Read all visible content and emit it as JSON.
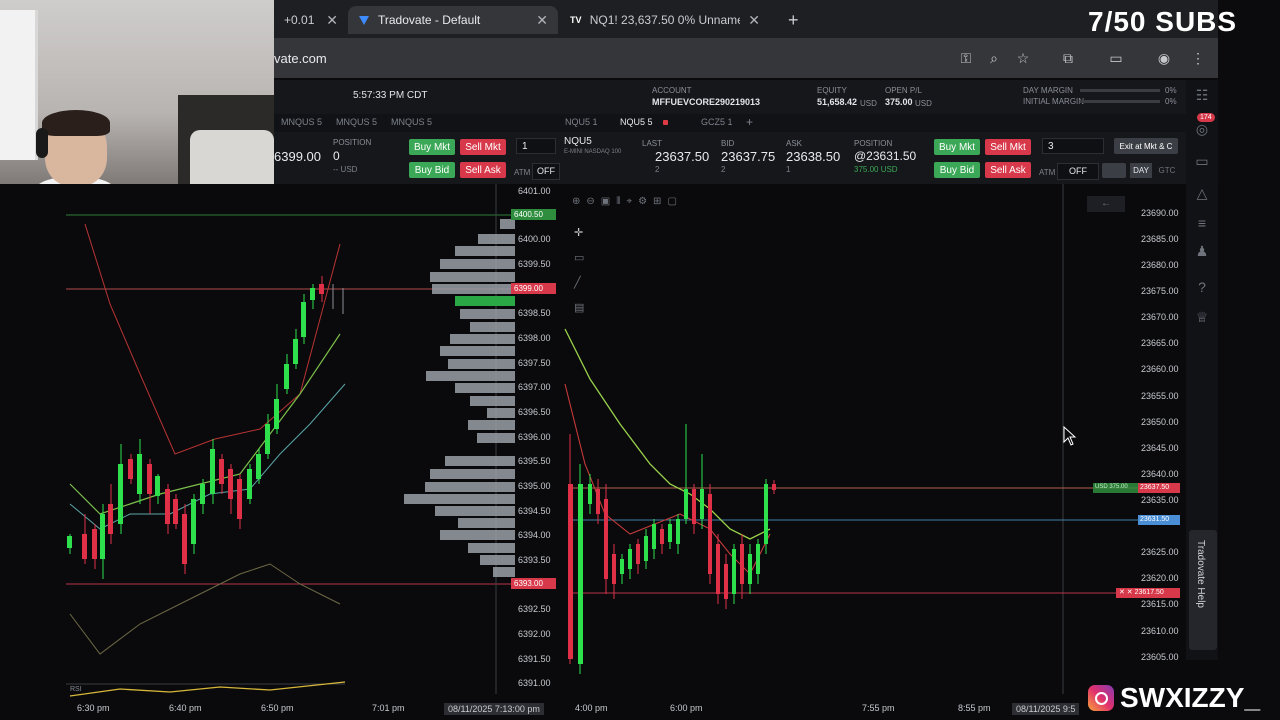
{
  "overlay": {
    "subs_counter": "7/50 SUBS",
    "social_handle": "SWXIZZY_"
  },
  "browser": {
    "tabs": [
      {
        "label": "+0.01",
        "icon": "partial-tab"
      },
      {
        "label": "Tradovate - Default",
        "icon": "tradovate-logo",
        "active": true
      },
      {
        "label": "NQ1! 23,637.50 0% Unname",
        "icon": "tradingview-logo"
      }
    ],
    "new_tab": "+",
    "url": "vate.com"
  },
  "app": {
    "time": "5:57:33 PM CDT",
    "account_label": "ACCOUNT",
    "account": "MFFUEVCORE290219013",
    "equity_label": "EQUITY",
    "equity": "51,658.42",
    "equity_unit": "USD",
    "open_pl_label": "OPEN P/L",
    "open_pl": "375.00",
    "open_pl_unit": "USD",
    "day_margin_label": "DAY MARGIN",
    "initial_margin_label": "INITIAL MARGIN",
    "day_margin_pct": "0%",
    "initial_margin_pct": "0%",
    "notif_badge": "174"
  },
  "left_panel": {
    "tabs": [
      "MNQUS 5",
      "MNQUS 5",
      "MNQUS 5"
    ],
    "last_price": "6399.00",
    "position_label": "POSITION",
    "position": "0",
    "pl_unit": "-- USD",
    "buy_mkt": "Buy Mkt",
    "sell_mkt": "Sell Mkt",
    "buy_bid": "Buy Bid",
    "sell_ask": "Sell Ask",
    "qty": "1",
    "atm": "ATM",
    "atm_state": "OFF"
  },
  "right_panel": {
    "tabs": [
      "NQU5 1",
      "NQU5 5",
      "GCZ5 1"
    ],
    "symbol": "NQU5",
    "symbol_sub": "E-MINI NASDAQ 100",
    "last_label": "LAST",
    "last": "23637.50",
    "last_sub": "2",
    "bid_label": "BID",
    "bid": "23637.75",
    "bid_sub": "2",
    "ask_label": "ASK",
    "ask": "23638.50",
    "ask_sub": "1",
    "position_label": "POSITION",
    "position": "@23631.50",
    "position_sub": "375.00 USD",
    "buy_mkt": "Buy Mkt",
    "sell_mkt": "Sell Mkt",
    "buy_bid": "Buy Bid",
    "sell_ask": "Sell Ask",
    "qty": "3",
    "exit_btn": "Exit at Mkt & C",
    "atm": "ATM",
    "atm_state": "OFF",
    "tif": "DAY",
    "tif2": "GTC"
  },
  "left_chart": {
    "y_labels": [
      "6401.00",
      "6400.00",
      "6399.50",
      "6399.00",
      "6398.50",
      "6398.00",
      "6397.50",
      "6397.00",
      "6396.50",
      "6396.00",
      "6395.50",
      "6395.00",
      "6394.50",
      "6394.00",
      "6393.50",
      "6393.00",
      "6392.50",
      "6392.00",
      "6391.50",
      "6391.00"
    ],
    "highlight_top": "6400.50",
    "highlight_red": "6399.00",
    "highlight_bottom": "6393.00",
    "x_labels": [
      "6:30 pm",
      "6:40 pm",
      "6:50 pm",
      "7:01 pm"
    ],
    "date_label": "08/11/2025 7:13:00 pm",
    "indicator_label": "RSI"
  },
  "right_chart": {
    "y_labels": [
      "23690.00",
      "23685.00",
      "23680.00",
      "23675.00",
      "23670.00",
      "23665.00",
      "23660.00",
      "23655.00",
      "23650.00",
      "23645.00",
      "23640.00",
      "23635.00",
      "23630.00",
      "23625.00",
      "23620.00",
      "23615.00",
      "23610.00",
      "23605.00"
    ],
    "tag_position": "23637.50",
    "tag_position_pl": "USD 375.00",
    "tag_last": "23631.50",
    "tag_stop": "23617.50",
    "x_labels": [
      "4:00 pm",
      "6:00 pm",
      "7:55 pm",
      "8:55 pm"
    ],
    "date_label": "08/11/2025 9:5"
  },
  "help_tab": "Tradovate Help"
}
